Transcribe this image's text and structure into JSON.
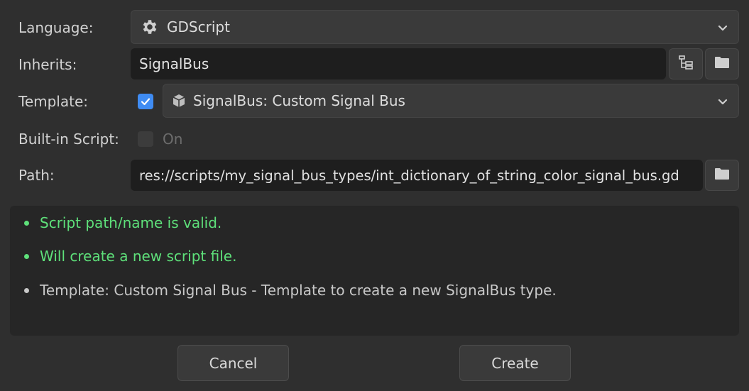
{
  "form": {
    "language": {
      "label": "Language:",
      "value": "GDScript",
      "icon": "gear-icon"
    },
    "inherits": {
      "label": "Inherits:",
      "value": "SignalBus",
      "tree_icon": "class-tree-icon",
      "folder_icon": "folder-icon"
    },
    "template": {
      "label": "Template:",
      "checked": true,
      "value": "SignalBus: Custom Signal Bus",
      "icon": "box-icon"
    },
    "builtin": {
      "label": "Built-in Script:",
      "checked": false,
      "toggle_label": "On"
    },
    "path": {
      "label": "Path:",
      "value": "res://scripts/my_signal_bus_types/int_dictionary_of_string_color_signal_bus.gd",
      "folder_icon": "folder-icon"
    }
  },
  "messages": [
    {
      "text": "Script path/name is valid.",
      "status": "ok"
    },
    {
      "text": "Will create a new script file.",
      "status": "ok"
    },
    {
      "text": "Template: Custom Signal Bus - Template to create a new SignalBus type.",
      "status": "info"
    }
  ],
  "buttons": {
    "cancel": "Cancel",
    "create": "Create"
  },
  "colors": {
    "ok": "#5ee07a",
    "accent": "#3f8cf3",
    "background": "#2f2f2f"
  }
}
